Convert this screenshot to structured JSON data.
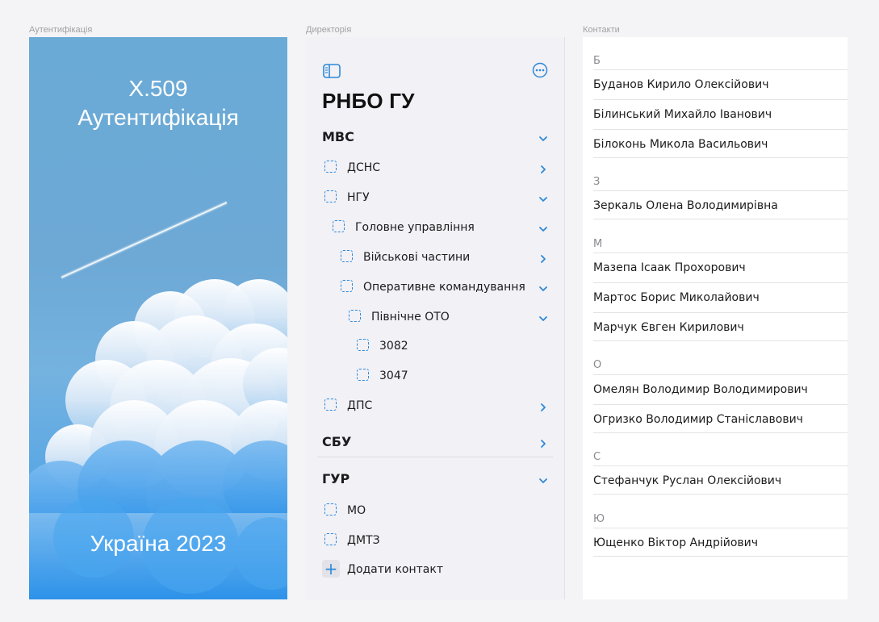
{
  "captions": {
    "auth": "Аутентифікація",
    "directory": "Директорія",
    "contacts": "Контакти"
  },
  "auth": {
    "title_line1": "X.509",
    "title_line2": "Аутентифікація",
    "footer": "Україна 2023"
  },
  "directory": {
    "title": "РНБО ГУ",
    "accent": "#2e88d8",
    "items": [
      {
        "label": "МВС",
        "chevron": "down"
      },
      {
        "label": "ДСНС",
        "chevron": "right"
      },
      {
        "label": "НГУ",
        "chevron": "down"
      },
      {
        "label": "Головне управління",
        "chevron": "down"
      },
      {
        "label": "Військові частини",
        "chevron": "right"
      },
      {
        "label": "Оперативне командування",
        "chevron": "down"
      },
      {
        "label": "Північне ОТО",
        "chevron": "down"
      },
      {
        "label": "3082",
        "chevron": "none"
      },
      {
        "label": "3047",
        "chevron": "none"
      },
      {
        "label": "ДПС",
        "chevron": "right"
      },
      {
        "label": "СБУ",
        "chevron": "right"
      },
      {
        "label": "ГУР",
        "chevron": "down"
      },
      {
        "label": "МО",
        "chevron": "none"
      },
      {
        "label": "ДМТЗ",
        "chevron": "none"
      }
    ],
    "add_contact": "Додати контакт"
  },
  "contacts": {
    "sections": [
      {
        "letter": "Б",
        "names": [
          "Буданов Кирило Олексійович",
          "Білинський Михайло Іванович",
          "Білоконь Микола Васильович"
        ]
      },
      {
        "letter": "З",
        "names": [
          "Зеркаль Олена Володимирівна"
        ]
      },
      {
        "letter": "М",
        "names": [
          "Мазепа Ісаак Прохорович",
          "Мартос Борис Миколайович",
          "Марчук Євген Кирилович"
        ]
      },
      {
        "letter": "О",
        "names": [
          "Омелян Володимир Володимирович",
          "Огризко Володимир Станіславович"
        ]
      },
      {
        "letter": "С",
        "names": [
          "Стефанчук Руслан Олексійович"
        ]
      },
      {
        "letter": "Ю",
        "names": [
          "Ющенко Віктор Андрійович"
        ]
      }
    ]
  }
}
